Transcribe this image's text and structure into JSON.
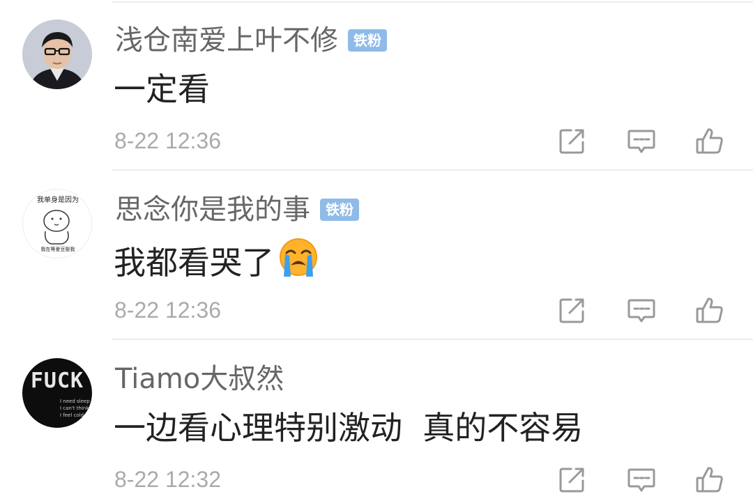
{
  "comments": [
    {
      "username": "浅仓南爱上叶不修",
      "badge": "铁粉",
      "text": "一定看",
      "emoji": "",
      "timestamp": "8-22 12:36",
      "avatar": "male-portrait-avatar"
    },
    {
      "username": "思念你是我的事",
      "badge": "铁粉",
      "text": "我都看哭了",
      "emoji": "loudly-crying-face-emoji",
      "timestamp": "8-22 12:36",
      "avatar": "cartoon-sketch-avatar",
      "avatar_text_top": "我单身是因为",
      "avatar_text_bottom": "我在等爱豆娶我"
    },
    {
      "username": "Tiamo大叔然",
      "badge": "",
      "text": "一边看心理特别激动  真的不容易",
      "emoji": "",
      "timestamp": "8-22 12:32",
      "avatar": "black-text-avatar",
      "avatar_text_top": "FUCK",
      "avatar_text_lines": [
        "I need sleep",
        "I can't think",
        "I feel cold"
      ]
    }
  ],
  "icons": {
    "share": "share-icon",
    "reply": "reply-comment-icon",
    "like": "thumbs-up-icon"
  },
  "colors": {
    "username": "#666666",
    "text": "#222222",
    "timestamp": "#aaaaaa",
    "badge_bg": "#8fbbe8",
    "icon": "#999999",
    "divider": "#ececec"
  }
}
